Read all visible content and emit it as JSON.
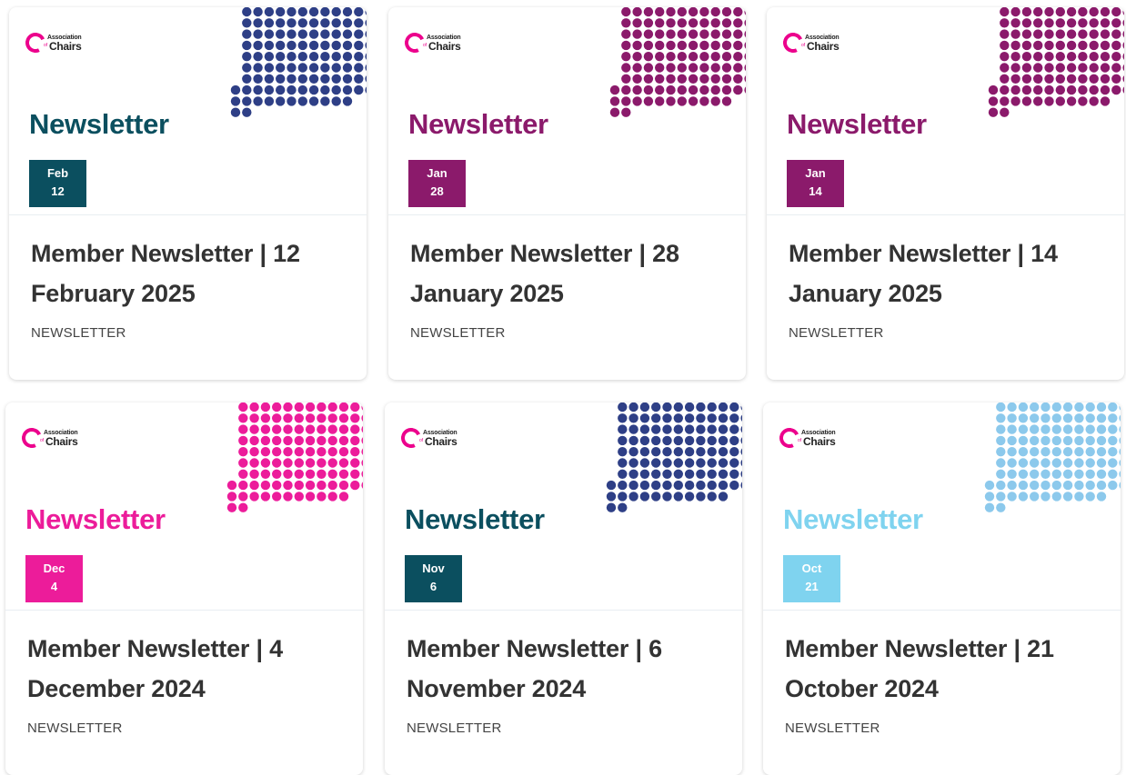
{
  "cards": [
    {
      "logo_top": "Association",
      "logo_of": "of",
      "logo_bottom": "Chairs",
      "heading": "Newsletter",
      "month": "Feb",
      "day": "12",
      "title": "Member Newsletter | 12 February 2025",
      "category": "NEWSLETTER",
      "accent": "#0b4f5f",
      "dots": "#2e3f86"
    },
    {
      "logo_top": "Association",
      "logo_of": "of",
      "logo_bottom": "Chairs",
      "heading": "Newsletter",
      "month": "Jan",
      "day": "28",
      "title": "Member Newsletter | 28 January 2025",
      "category": "NEWSLETTER",
      "accent": "#8b1a6b",
      "dots": "#8b1a6b"
    },
    {
      "logo_top": "Association",
      "logo_of": "of",
      "logo_bottom": "Chairs",
      "heading": "Newsletter",
      "month": "Jan",
      "day": "14",
      "title": "Member Newsletter | 14 January 2025",
      "category": "NEWSLETTER",
      "accent": "#8b1a6b",
      "dots": "#8b1a6b"
    },
    {
      "logo_top": "Association",
      "logo_of": "of",
      "logo_bottom": "Chairs",
      "heading": "Newsletter",
      "month": "Dec",
      "day": "4",
      "title": "Member Newsletter | 4 December 2024",
      "category": "NEWSLETTER",
      "accent": "#ec1c9a",
      "dots": "#ec1c9a"
    },
    {
      "logo_top": "Association",
      "logo_of": "of",
      "logo_bottom": "Chairs",
      "heading": "Newsletter",
      "month": "Nov",
      "day": "6",
      "title": "Member Newsletter | 6 November 2024",
      "category": "NEWSLETTER",
      "accent": "#0b4f5f",
      "dots": "#2e3f86"
    },
    {
      "logo_top": "Association",
      "logo_of": "of",
      "logo_bottom": "Chairs",
      "heading": "Newsletter",
      "month": "Oct",
      "day": "21",
      "title": "Member Newsletter | 21 October 2024",
      "category": "NEWSLETTER",
      "accent": "#7fd3ef",
      "dots": "#8cc9ec"
    }
  ]
}
